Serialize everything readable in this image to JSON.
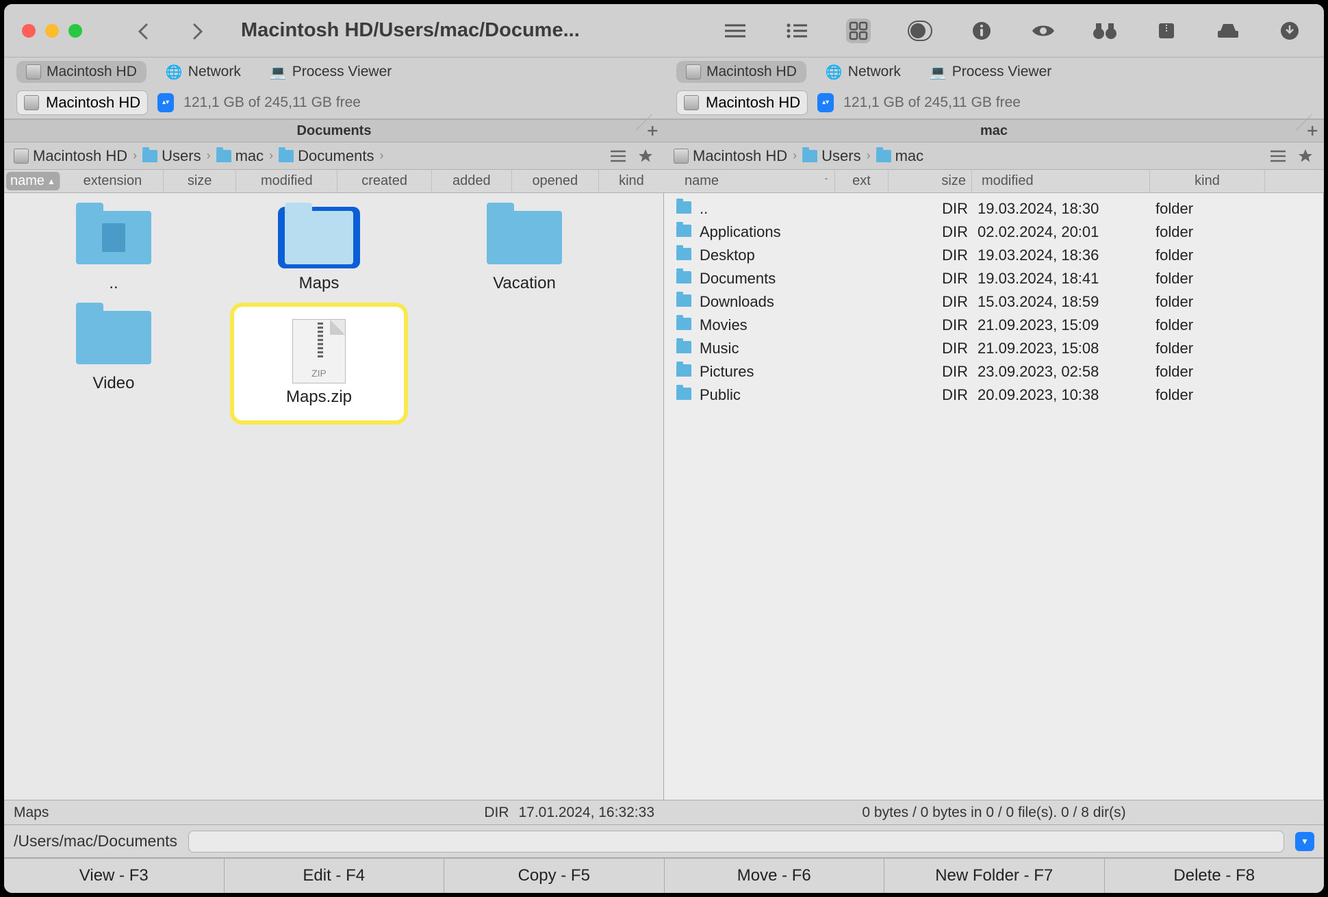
{
  "title_path": "Macintosh HD/Users/mac/Docume...",
  "loc_tabs": {
    "hd": "Macintosh HD",
    "network": "Network",
    "process": "Process Viewer"
  },
  "volume": {
    "name": "Macintosh HD",
    "free": "121,1 GB of 245,11 GB free"
  },
  "panels": {
    "left_label": "Documents",
    "right_label": "mac"
  },
  "breadcrumb_left": {
    "seg0": "Macintosh HD",
    "seg1": "Users",
    "seg2": "mac",
    "seg3": "Documents"
  },
  "breadcrumb_right": {
    "seg0": "Macintosh HD",
    "seg1": "Users",
    "seg2": "mac"
  },
  "cols_left": {
    "name": "name",
    "ext": "extension",
    "size": "size",
    "mod": "modified",
    "created": "created",
    "added": "added",
    "opened": "opened",
    "kind": "kind"
  },
  "cols_right": {
    "name": "name",
    "ext": "ext",
    "size": "size",
    "mod": "modified",
    "kind": "kind"
  },
  "icons_left": {
    "0": {
      "label": ".."
    },
    "1": {
      "label": "Maps"
    },
    "2": {
      "label": "Vacation"
    },
    "3": {
      "label": "Video"
    },
    "4": {
      "label": "Maps.zip"
    }
  },
  "list_right": [
    {
      "name": "..",
      "size": "DIR",
      "mod": "19.03.2024, 18:30",
      "kind": "folder"
    },
    {
      "name": "Applications",
      "size": "DIR",
      "mod": "02.02.2024, 20:01",
      "kind": "folder"
    },
    {
      "name": "Desktop",
      "size": "DIR",
      "mod": "19.03.2024, 18:36",
      "kind": "folder"
    },
    {
      "name": "Documents",
      "size": "DIR",
      "mod": "19.03.2024, 18:41",
      "kind": "folder"
    },
    {
      "name": "Downloads",
      "size": "DIR",
      "mod": "15.03.2024, 18:59",
      "kind": "folder"
    },
    {
      "name": "Movies",
      "size": "DIR",
      "mod": "21.09.2023, 15:09",
      "kind": "folder"
    },
    {
      "name": "Music",
      "size": "DIR",
      "mod": "21.09.2023, 15:08",
      "kind": "folder"
    },
    {
      "name": "Pictures",
      "size": "DIR",
      "mod": "23.09.2023, 02:58",
      "kind": "folder"
    },
    {
      "name": "Public",
      "size": "DIR",
      "mod": "20.09.2023, 10:38",
      "kind": "folder"
    }
  ],
  "status": {
    "left_name": "Maps",
    "left_type": "DIR",
    "left_date": "17.01.2024, 16:32:33",
    "right": "0 bytes / 0 bytes in 0 / 0 file(s). 0 / 8 dir(s)"
  },
  "path": "/Users/mac/Documents",
  "bottom": {
    "view": "View - F3",
    "edit": "Edit - F4",
    "copy": "Copy - F5",
    "move": "Move - F6",
    "newf": "New Folder - F7",
    "del": "Delete - F8"
  }
}
